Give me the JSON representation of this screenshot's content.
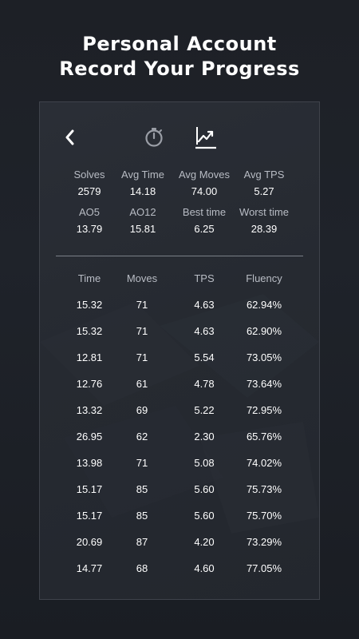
{
  "headline": {
    "line1": "Personal Account",
    "line2": "Record Your Progress"
  },
  "toolbar": {
    "back_icon": "chevron-left-icon",
    "timer_icon": "stopwatch-icon",
    "chart_icon": "trend-chart-icon"
  },
  "stats": [
    [
      {
        "label": "Solves",
        "value": "2579"
      },
      {
        "label": "Avg Time",
        "value": "14.18"
      },
      {
        "label": "Avg Moves",
        "value": "74.00"
      },
      {
        "label": "Avg TPS",
        "value": "5.27"
      }
    ],
    [
      {
        "label": "AO5",
        "value": "13.79"
      },
      {
        "label": "AO12",
        "value": "15.81"
      },
      {
        "label": "Best time",
        "value": "6.25"
      },
      {
        "label": "Worst time",
        "value": "28.39"
      }
    ]
  ],
  "table": {
    "headers": [
      "Time",
      "Moves",
      "TPS",
      "Fluency"
    ],
    "rows": [
      [
        "15.32",
        "71",
        "4.63",
        "62.94%"
      ],
      [
        "15.32",
        "71",
        "4.63",
        "62.90%"
      ],
      [
        "12.81",
        "71",
        "5.54",
        "73.05%"
      ],
      [
        "12.76",
        "61",
        "4.78",
        "73.64%"
      ],
      [
        "13.32",
        "69",
        "5.22",
        "72.95%"
      ],
      [
        "26.95",
        "62",
        "2.30",
        "65.76%"
      ],
      [
        "13.98",
        "71",
        "5.08",
        "74.02%"
      ],
      [
        "15.17",
        "85",
        "5.60",
        "75.73%"
      ],
      [
        "15.17",
        "85",
        "5.60",
        "75.70%"
      ],
      [
        "20.69",
        "87",
        "4.20",
        "73.29%"
      ],
      [
        "14.77",
        "68",
        "4.60",
        "77.05%"
      ]
    ]
  },
  "colors": {
    "background": "#1d2026",
    "panel": "#262a31",
    "label": "#b8bcc4",
    "value": "#ffffff",
    "icon_muted": "#9a9ea6"
  }
}
